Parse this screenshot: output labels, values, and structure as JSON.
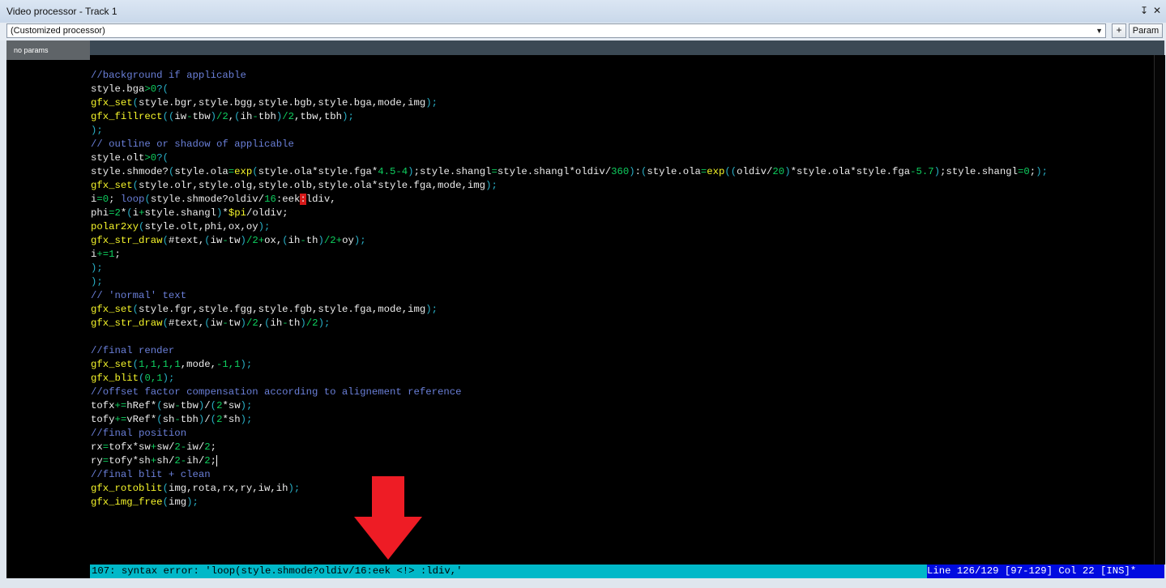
{
  "window": {
    "title": "Video processor - Track 1",
    "pin_glyph": "↧",
    "close_glyph": "✕"
  },
  "toolbar": {
    "processor_selected": "(Customized processor)",
    "plus_label": "+",
    "param_label": "Param"
  },
  "sidebar": {
    "items": [
      {
        "label": "no params"
      }
    ]
  },
  "editor": {
    "lines": [
      [],
      [
        [
          "c",
          "//background if applicable"
        ]
      ],
      [
        [
          "d",
          "style.bga"
        ],
        [
          "s",
          ">0"
        ],
        [
          "p",
          "?("
        ]
      ],
      [
        [
          "f",
          "gfx_set"
        ],
        [
          "p",
          "("
        ],
        [
          "d",
          "style.bgr,style.bgg,style.bgb,style.bga,mode,img"
        ],
        [
          "p",
          ");"
        ]
      ],
      [
        [
          "f",
          "gfx_fillrect"
        ],
        [
          "p",
          "(("
        ],
        [
          "d",
          "iw"
        ],
        [
          "s",
          "-"
        ],
        [
          "d",
          "tbw"
        ],
        [
          "p",
          ")"
        ],
        [
          "s",
          "/2"
        ],
        [
          "d",
          ","
        ],
        [
          "p",
          "("
        ],
        [
          "d",
          "ih"
        ],
        [
          "s",
          "-"
        ],
        [
          "d",
          "tbh"
        ],
        [
          "p",
          ")"
        ],
        [
          "s",
          "/2"
        ],
        [
          "d",
          ",tbw,tbh"
        ],
        [
          "p",
          ");"
        ]
      ],
      [
        [
          "p",
          ");"
        ]
      ],
      [
        [
          "c",
          "// outline or shadow of applicable"
        ]
      ],
      [
        [
          "d",
          "style.olt"
        ],
        [
          "s",
          ">0"
        ],
        [
          "p",
          "?("
        ]
      ],
      [
        [
          "d",
          "style.shmode?"
        ],
        [
          "p",
          "("
        ],
        [
          "d",
          "style.ola"
        ],
        [
          "s",
          "="
        ],
        [
          "f",
          "exp"
        ],
        [
          "p",
          "("
        ],
        [
          "d",
          "style.ola*style.fga*"
        ],
        [
          "s",
          "4.5-4"
        ],
        [
          "p",
          ")"
        ],
        [
          "d",
          ";style.shangl"
        ],
        [
          "s",
          "="
        ],
        [
          "d",
          "style.shangl*oldiv/"
        ],
        [
          "s",
          "360"
        ],
        [
          "p",
          ")"
        ],
        [
          "d",
          ":"
        ],
        [
          "p",
          "("
        ],
        [
          "d",
          "style.ola"
        ],
        [
          "s",
          "="
        ],
        [
          "f",
          "exp"
        ],
        [
          "p",
          "(("
        ],
        [
          "d",
          "oldiv/"
        ],
        [
          "s",
          "20"
        ],
        [
          "p",
          ")"
        ],
        [
          "d",
          "*style.ola*style.fga"
        ],
        [
          "s",
          "-5.7"
        ],
        [
          "p",
          ")"
        ],
        [
          "d",
          ";style.shangl"
        ],
        [
          "s",
          "=0"
        ],
        [
          "d",
          ";"
        ],
        [
          "p",
          ");"
        ]
      ],
      [
        [
          "f",
          "gfx_set"
        ],
        [
          "p",
          "("
        ],
        [
          "d",
          "style.olr,style.olg,style.olb,style.ola*style.fga,mode,img"
        ],
        [
          "p",
          ");"
        ]
      ],
      [
        [
          "d",
          "i"
        ],
        [
          "s",
          "=0"
        ],
        [
          "d",
          "; "
        ],
        [
          "k",
          "loop"
        ],
        [
          "p",
          "("
        ],
        [
          "d",
          "style.shmode?oldiv/"
        ],
        [
          "s",
          "16"
        ],
        [
          "d",
          ":eek"
        ],
        [
          "e",
          ":"
        ],
        [
          "d",
          "ldiv,"
        ]
      ],
      [
        [
          "d",
          "phi"
        ],
        [
          "s",
          "=2"
        ],
        [
          "d",
          "*"
        ],
        [
          "p",
          "("
        ],
        [
          "d",
          "i"
        ],
        [
          "s",
          "+"
        ],
        [
          "d",
          "style.shangl"
        ],
        [
          "p",
          ")"
        ],
        [
          "d",
          "*"
        ],
        [
          "f",
          "$pi"
        ],
        [
          "d",
          "/oldiv;"
        ]
      ],
      [
        [
          "f",
          "polar2xy"
        ],
        [
          "p",
          "("
        ],
        [
          "d",
          "style.olt,phi,ox,oy"
        ],
        [
          "p",
          ");"
        ]
      ],
      [
        [
          "f",
          "gfx_str_draw"
        ],
        [
          "p",
          "("
        ],
        [
          "d",
          "#text,"
        ],
        [
          "p",
          "("
        ],
        [
          "d",
          "iw"
        ],
        [
          "s",
          "-"
        ],
        [
          "d",
          "tw"
        ],
        [
          "p",
          ")"
        ],
        [
          "s",
          "/2+"
        ],
        [
          "d",
          "ox,"
        ],
        [
          "p",
          "("
        ],
        [
          "d",
          "ih"
        ],
        [
          "s",
          "-"
        ],
        [
          "d",
          "th"
        ],
        [
          "p",
          ")"
        ],
        [
          "s",
          "/2+"
        ],
        [
          "d",
          "oy"
        ],
        [
          "p",
          ");"
        ]
      ],
      [
        [
          "d",
          "i"
        ],
        [
          "s",
          "+=1"
        ],
        [
          "d",
          ";"
        ]
      ],
      [
        [
          "p",
          ");"
        ]
      ],
      [
        [
          "p",
          ");"
        ]
      ],
      [
        [
          "c",
          "// 'normal' text"
        ]
      ],
      [
        [
          "f",
          "gfx_set"
        ],
        [
          "p",
          "("
        ],
        [
          "d",
          "style.fgr,style.fgg,style.fgb,style.fga,mode,img"
        ],
        [
          "p",
          ");"
        ]
      ],
      [
        [
          "f",
          "gfx_str_draw"
        ],
        [
          "p",
          "("
        ],
        [
          "d",
          "#text,"
        ],
        [
          "p",
          "("
        ],
        [
          "d",
          "iw"
        ],
        [
          "s",
          "-"
        ],
        [
          "d",
          "tw"
        ],
        [
          "p",
          ")"
        ],
        [
          "s",
          "/2"
        ],
        [
          "d",
          ","
        ],
        [
          "p",
          "("
        ],
        [
          "d",
          "ih"
        ],
        [
          "s",
          "-"
        ],
        [
          "d",
          "th"
        ],
        [
          "p",
          ")"
        ],
        [
          "s",
          "/2"
        ],
        [
          "p",
          ");"
        ]
      ],
      [],
      [
        [
          "c",
          "//final render"
        ]
      ],
      [
        [
          "f",
          "gfx_set"
        ],
        [
          "p",
          "("
        ],
        [
          "s",
          "1,1,1,1"
        ],
        [
          "d",
          ",mode,"
        ],
        [
          "s",
          "-1,1"
        ],
        [
          "p",
          ");"
        ]
      ],
      [
        [
          "f",
          "gfx_blit"
        ],
        [
          "p",
          "("
        ],
        [
          "s",
          "0,1"
        ],
        [
          "p",
          ");"
        ]
      ],
      [
        [
          "c",
          "//offset factor compensation according to alignement reference"
        ]
      ],
      [
        [
          "d",
          "tofx"
        ],
        [
          "s",
          "+="
        ],
        [
          "d",
          "hRef*"
        ],
        [
          "p",
          "("
        ],
        [
          "d",
          "sw"
        ],
        [
          "s",
          "-"
        ],
        [
          "d",
          "tbw"
        ],
        [
          "p",
          ")"
        ],
        [
          "d",
          "/"
        ],
        [
          "p",
          "("
        ],
        [
          "s",
          "2"
        ],
        [
          "d",
          "*sw"
        ],
        [
          "p",
          ");"
        ]
      ],
      [
        [
          "d",
          "tofy"
        ],
        [
          "s",
          "+="
        ],
        [
          "d",
          "vRef*"
        ],
        [
          "p",
          "("
        ],
        [
          "d",
          "sh"
        ],
        [
          "s",
          "-"
        ],
        [
          "d",
          "tbh"
        ],
        [
          "p",
          ")"
        ],
        [
          "d",
          "/"
        ],
        [
          "p",
          "("
        ],
        [
          "s",
          "2"
        ],
        [
          "d",
          "*sh"
        ],
        [
          "p",
          ");"
        ]
      ],
      [
        [
          "c",
          "//final position"
        ]
      ],
      [
        [
          "d",
          "rx"
        ],
        [
          "s",
          "="
        ],
        [
          "d",
          "tofx*sw"
        ],
        [
          "s",
          "+"
        ],
        [
          "d",
          "sw/"
        ],
        [
          "s",
          "2-"
        ],
        [
          "d",
          "iw/"
        ],
        [
          "s",
          "2"
        ],
        [
          "d",
          ";"
        ]
      ],
      [
        [
          "d",
          "ry"
        ],
        [
          "s",
          "="
        ],
        [
          "d",
          "tofy*sh"
        ],
        [
          "s",
          "+"
        ],
        [
          "d",
          "sh/"
        ],
        [
          "s",
          "2-"
        ],
        [
          "d",
          "ih/"
        ],
        [
          "s",
          "2"
        ],
        [
          "d",
          ";"
        ],
        [
          "cursor",
          ""
        ]
      ],
      [
        [
          "c",
          "//final blit + clean"
        ]
      ],
      [
        [
          "f",
          "gfx_rotoblit"
        ],
        [
          "p",
          "("
        ],
        [
          "d",
          "img,rota,rx,ry,iw,ih"
        ],
        [
          "p",
          ");"
        ]
      ],
      [
        [
          "f",
          "gfx_img_free"
        ],
        [
          "p",
          "("
        ],
        [
          "d",
          "img"
        ],
        [
          "p",
          ");"
        ]
      ]
    ]
  },
  "status": {
    "error_text": "107: syntax error: 'loop(style.shmode?oldiv/16:eek <!> :ldiv,'",
    "position_text": "Line 126/129 [97-129] Col 22 [INS]*"
  },
  "annotation": {
    "arrow_color": "#ee1c25"
  }
}
